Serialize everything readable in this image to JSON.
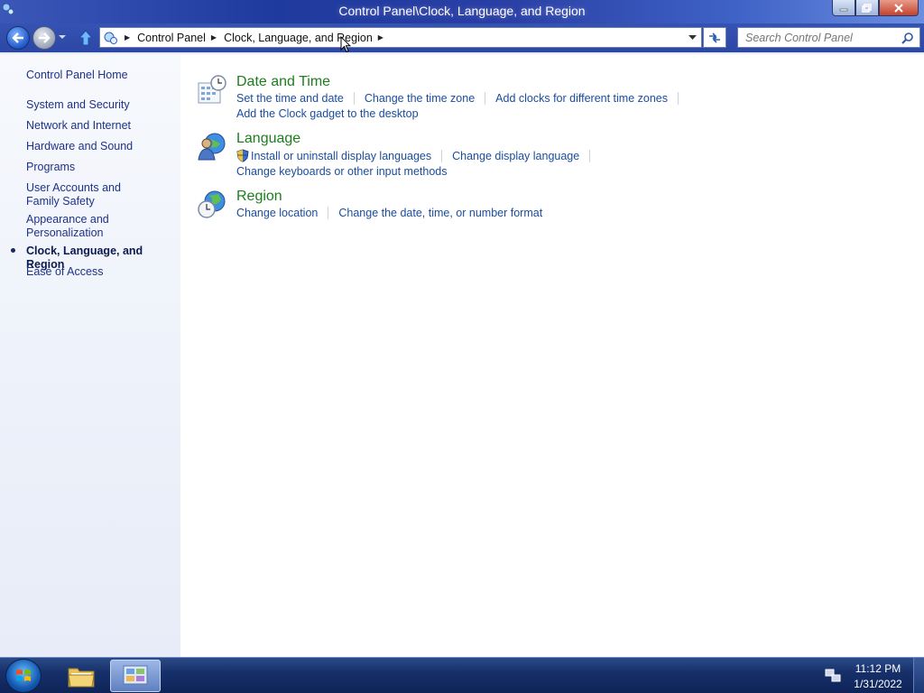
{
  "window": {
    "title": "Control Panel\\Clock, Language, and Region"
  },
  "navbar": {
    "breadcrumbs": [
      "Control Panel",
      "Clock, Language, and Region"
    ],
    "search_placeholder": "Search Control Panel"
  },
  "sidebar": {
    "items": [
      {
        "label": "Control Panel Home",
        "current": false
      },
      {
        "label": "System and Security",
        "current": false
      },
      {
        "label": "Network and Internet",
        "current": false
      },
      {
        "label": "Hardware and Sound",
        "current": false
      },
      {
        "label": "Programs",
        "current": false
      },
      {
        "label": "User Accounts and Family Safety",
        "current": false
      },
      {
        "label": "Appearance and Personalization",
        "current": false
      },
      {
        "label": "Clock, Language, and Region",
        "current": true
      },
      {
        "label": "Ease of Access",
        "current": false
      }
    ]
  },
  "categories": [
    {
      "title": "Date and Time",
      "icon": "date-time-icon",
      "links": [
        "Set the time and date",
        "Change the time zone",
        "Add clocks for different time zones",
        "Add the Clock gadget to the desktop"
      ]
    },
    {
      "title": "Language",
      "icon": "language-icon",
      "links": [
        "Install or uninstall display languages",
        "Change display language",
        "Change keyboards or other input methods"
      ]
    },
    {
      "title": "Region",
      "icon": "region-icon",
      "links": [
        "Change location",
        "Change the date, time, or number format"
      ]
    }
  ],
  "taskbar": {
    "time": "11:12 PM",
    "date": "1/31/2022"
  },
  "colors": {
    "category_title": "#1e7d1e",
    "link": "#1a4c9c",
    "sidebar_link": "#1e3287"
  }
}
